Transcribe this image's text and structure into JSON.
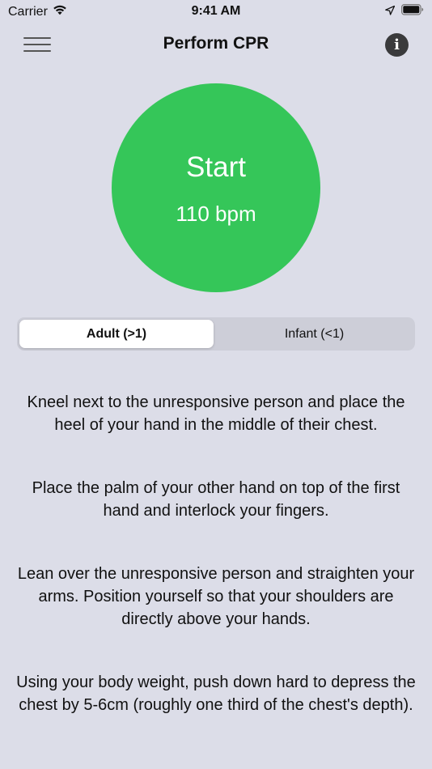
{
  "status_bar": {
    "carrier": "Carrier",
    "time": "9:41 AM"
  },
  "nav": {
    "title": "Perform CPR",
    "info_glyph": "i"
  },
  "start_button": {
    "label": "Start",
    "rate": "110 bpm",
    "color": "#35c659"
  },
  "segments": {
    "options": [
      "Adult (>1)",
      "Infant (<1)"
    ],
    "selected": "Adult (>1)"
  },
  "instructions": [
    "Kneel next to the unresponsive person and place the heel of your hand in the middle of their chest.",
    "Place the palm of your other hand on top of the first hand and interlock your fingers.",
    "Lean over the unresponsive person and straighten your arms. Position yourself so that your shoulders are directly above your hands.",
    "Using your body weight, push down hard to depress the chest by 5-6cm (roughly one third of the chest's depth)."
  ],
  "icons": {
    "wifi": "wifi-icon",
    "location": "location-arrow-icon",
    "battery": "battery-icon",
    "menu": "hamburger-menu-icon",
    "info": "info-icon"
  }
}
